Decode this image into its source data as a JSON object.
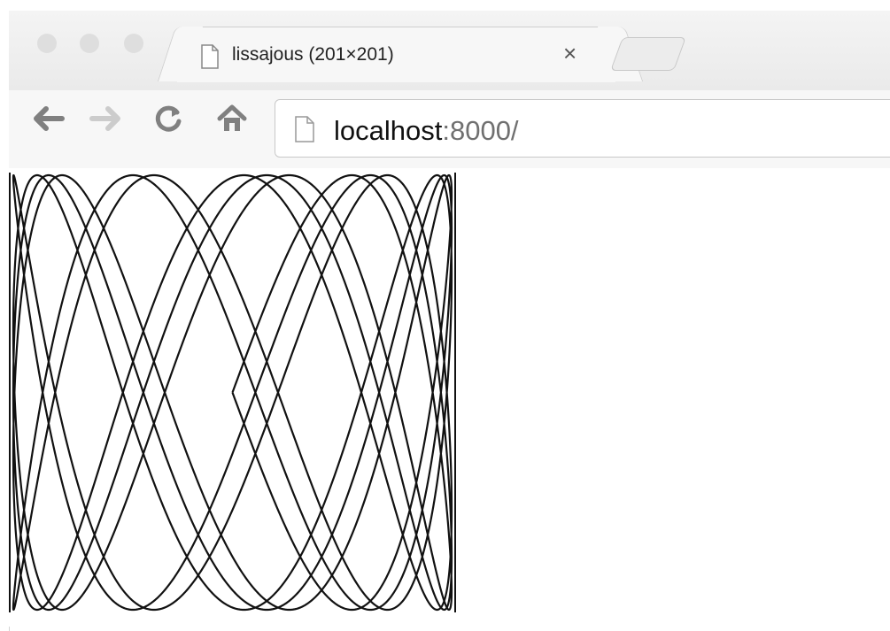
{
  "tab": {
    "title": "lissajous (201×201)",
    "close_label": "×"
  },
  "toolbar": {
    "back_icon": "back-arrow-icon",
    "forward_icon": "forward-arrow-icon",
    "reload_icon": "reload-icon",
    "home_icon": "home-icon"
  },
  "address_bar": {
    "host": "localhost",
    "rest": ":8000/"
  },
  "colors": {
    "curve": "#111111",
    "toolbar_bg": "#f7f7f7",
    "url_secondary": "#707070"
  },
  "image": {
    "name": "lissajous",
    "freq_x": 3.0,
    "freq_y": 1.0,
    "phase_drift": 0.1
  }
}
